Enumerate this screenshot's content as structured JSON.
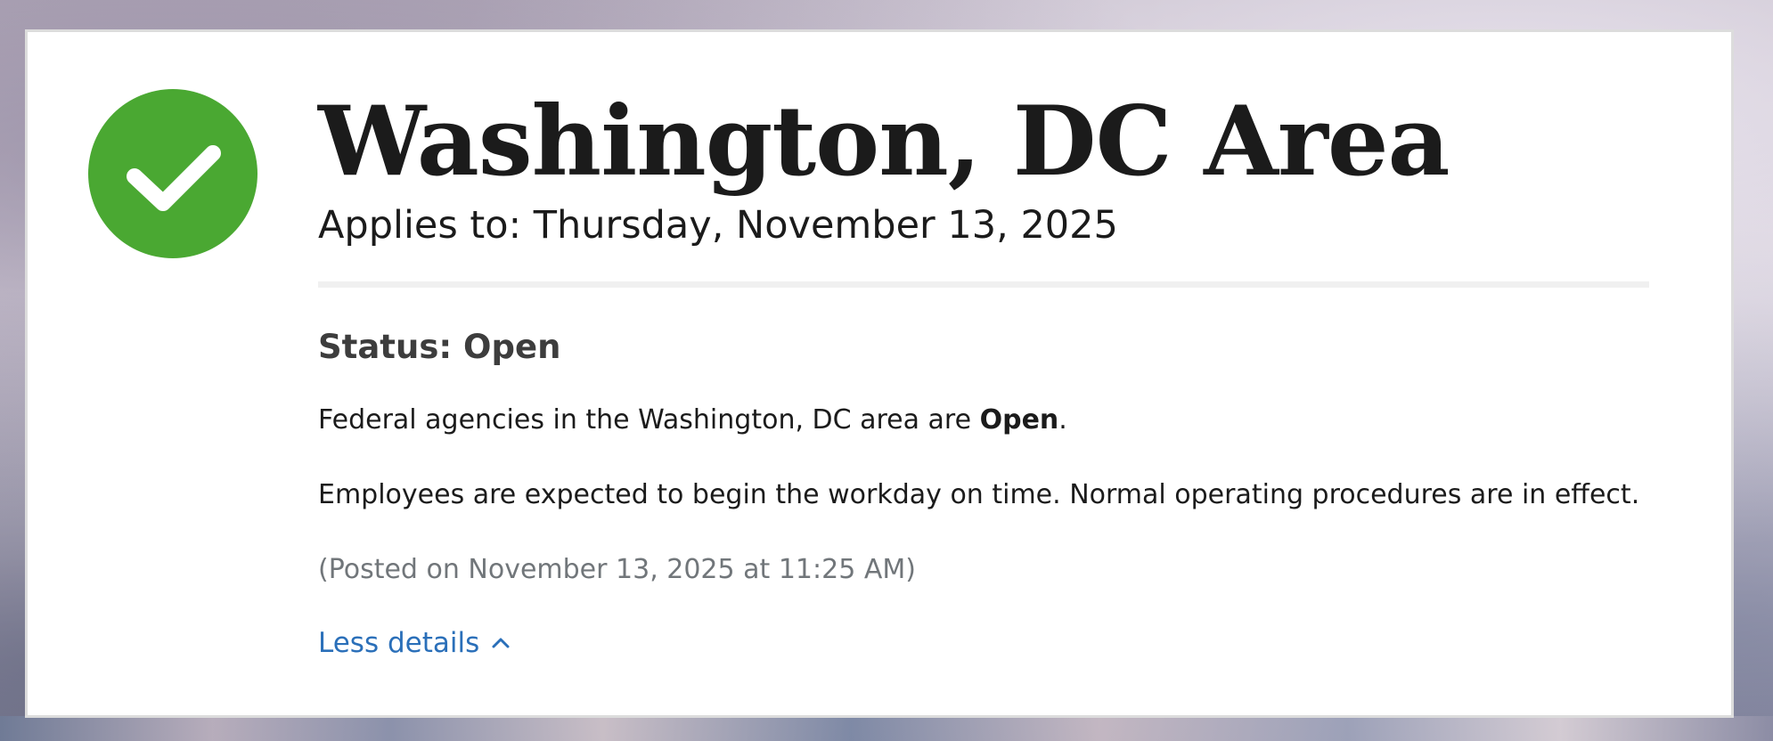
{
  "location": {
    "title": "Washington, DC Area",
    "applies_to": "Applies to: Thursday, November 13, 2025"
  },
  "status": {
    "heading": "Status: Open",
    "icon": "check-circle-icon",
    "icon_color": "#4aa832"
  },
  "message": {
    "line1_prefix": "Federal agencies in the Washington, DC area are ",
    "line1_emphasis": "Open",
    "line1_suffix": ".",
    "line2": "Employees are expected to begin the workday on time. Normal operating procedures are in effect."
  },
  "posted": "(Posted on November 13, 2025 at 11:25 AM)",
  "details_toggle": {
    "label": "Less details",
    "icon": "chevron-up-icon",
    "color": "#2a6fb9"
  }
}
